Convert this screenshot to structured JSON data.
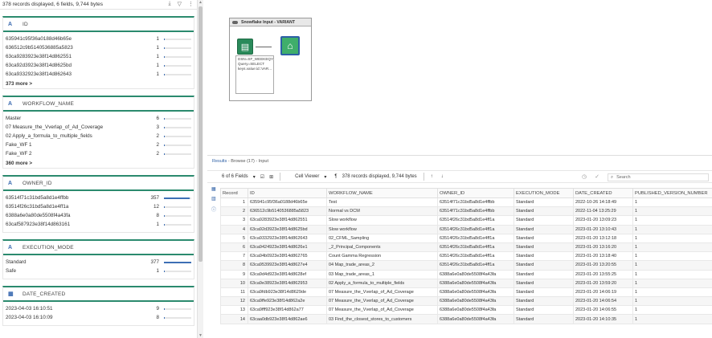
{
  "profile": {
    "summary": "378 records displayed, 6 fields, 9,744 bytes",
    "cards": [
      {
        "icon": "A",
        "title": "ID",
        "rows": [
          {
            "value": "635941c95f36a0188d46b65e",
            "count": 1,
            "frac": 0.01
          },
          {
            "value": "636512c9b5140536885a5823",
            "count": 1,
            "frac": 0.01
          },
          {
            "value": "63ca9283923e38f14d862551",
            "count": 1,
            "frac": 0.01
          },
          {
            "value": "63ca92d3923e38f14d8625bd",
            "count": 1,
            "frac": 0.01
          },
          {
            "value": "63ca9332923e38f14d862643",
            "count": 1,
            "frac": 0.01
          }
        ],
        "more": "373 more >"
      },
      {
        "icon": "A",
        "title": "WORKFLOW_NAME",
        "rows": [
          {
            "value": "Master",
            "count": 6,
            "frac": 0.02
          },
          {
            "value": "07 Measure_the_Vverlap_of_Ad_Coverage",
            "count": 3,
            "frac": 0.01
          },
          {
            "value": "02 Apply_a_formula_to_multiple_fields",
            "count": 2,
            "frac": 0.01
          },
          {
            "value": "Fake_WF 1",
            "count": 2,
            "frac": 0.01
          },
          {
            "value": "Fake_WF 2",
            "count": 2,
            "frac": 0.01
          }
        ],
        "more": "360 more >"
      },
      {
        "icon": "A",
        "title": "OWNER_ID",
        "rows": [
          {
            "value": "63514f71c31bd5a8d1e4ffbb",
            "count": 357,
            "frac": 0.94
          },
          {
            "value": "63514f26c31bd5a8d1e4ff1a",
            "count": 12,
            "frac": 0.03
          },
          {
            "value": "6388a6e0a80de5508f4a43fa",
            "count": 8,
            "frac": 0.02
          },
          {
            "value": "63caf587923e38f14d863161",
            "count": 1,
            "frac": 0.01
          }
        ],
        "more": ""
      },
      {
        "icon": "A",
        "title": "EXECUTION_MODE",
        "rows": [
          {
            "value": "Standard",
            "count": 377,
            "frac": 0.99
          },
          {
            "value": "Safe",
            "count": 1,
            "frac": 0.01
          }
        ],
        "more": ""
      },
      {
        "icon": "▦",
        "title": "DATE_CREATED",
        "rows": [
          {
            "value": "2023-04-03 16:10:51",
            "count": 9,
            "frac": 0.02
          },
          {
            "value": "2023-04-03 16:10:09",
            "count": 8,
            "frac": 0.02
          }
        ],
        "more": ""
      }
    ]
  },
  "canvas": {
    "tool_title": "Snowflake Input - VARIANT",
    "annotation": "DSN=SF_WEEKEQY_CHALLENGES_TRIAL Query=SELECT keys.value:id::VAR..."
  },
  "results": {
    "title_prefix": "Results",
    "title_rest": " - Browse (17) - Input",
    "fields_label": "6 of 6 Fields",
    "cell_viewer": "Cell Viewer",
    "records_info": "378 records displayed, 9,744 bytes",
    "search_placeholder": "Search",
    "columns": [
      "Record",
      "ID",
      "WORKFLOW_NAME",
      "OWNER_ID",
      "EXECUTION_MODE",
      "DATE_CREATED",
      "PUBLISHED_VERSION_NUMBER"
    ],
    "rows": [
      [
        "1",
        "635941c95f36a0188d46b65e",
        "Test",
        "63514f71c31bd5a8d1e4ffbb",
        "Standard",
        "2022-10-26 14:18:49",
        "1"
      ],
      [
        "2",
        "636512c9b5140536885a5823",
        "Normal vs DCM",
        "63514f71c31bd5a8d1e4ffbb",
        "Standard",
        "2022-11-04 13:25:29",
        "1"
      ],
      [
        "3",
        "63ca9283923e38f14d862551",
        "Slow workflow",
        "63514f26c31bd5a8d1e4ff1a",
        "Standard",
        "2023-01-20 13:09:23",
        "1"
      ],
      [
        "4",
        "63ca92d3923e38f14d8625bd",
        "Slow workflow",
        "63514f26c31bd5a8d1e4ff1a",
        "Standard",
        "2023-01-20 13:10:43",
        "1"
      ],
      [
        "5",
        "63ca9332923e38f14d862643",
        "02_CFML_Sampling",
        "63514f26c31bd5a8d1e4ff1a",
        "Standard",
        "2023-01-20 13:12:18",
        "1"
      ],
      [
        "6",
        "63ca9424923e38f14d8626e1",
        "_2_Principal_Components",
        "63514f26c31bd5a8d1e4ff1a",
        "Standard",
        "2023-01-20 13:16:20",
        "1"
      ],
      [
        "7",
        "63ca94b0923e38f14d862765",
        "Count Gamma Regression",
        "63514f26c31bd5a8d1e4ff1a",
        "Standard",
        "2023-01-20 13:18:40",
        "1"
      ],
      [
        "8",
        "63ca9539923e38f14d8627e4",
        "04 Map_trade_areas_2",
        "63514f26c31bd5a8d1e4ff1a",
        "Standard",
        "2023-01-20 13:20:55",
        "1"
      ],
      [
        "9",
        "63ca9d4d923e38f14d8628ef",
        "03 Map_trade_areas_1",
        "6388a6e0a80de5508f4a43fa",
        "Standard",
        "2023-01-20 13:55:25",
        "1"
      ],
      [
        "10",
        "63ca9e38923e38f14d862953",
        "02 Apply_a_formula_to_multiple_fields",
        "6388a6e0a80de5508f4a43fa",
        "Standard",
        "2023-01-20 13:59:20",
        "1"
      ],
      [
        "11",
        "63ca9fdb923e38f14d8629de",
        "07 Measure_the_Vverlap_of_Ad_Coverage",
        "6388a6e0a80de5508f4a43fa",
        "Standard",
        "2023-01-20 14:06:19",
        "1"
      ],
      [
        "12",
        "63ca9ffe923e38f14d862a2e",
        "07 Measure_the_Vverlap_of_Ad_Coverage",
        "6388a6e0a80de5508f4a43fa",
        "Standard",
        "2023-01-20 14:06:54",
        "1"
      ],
      [
        "13",
        "63ca9fff923e38f14d862a77",
        "07 Measure_the_Vverlap_of_Ad_Coverage",
        "6388a6e0a80de5508f4a43fa",
        "Standard",
        "2023-01-20 14:06:55",
        "1"
      ],
      [
        "14",
        "63caa0db923e38f14d862ae6",
        "03 Find_the_closest_stores_to_customers",
        "6388a6e0a80de5508f4a43fa",
        "Standard",
        "2023-01-20 14:10:35",
        "1"
      ]
    ]
  }
}
